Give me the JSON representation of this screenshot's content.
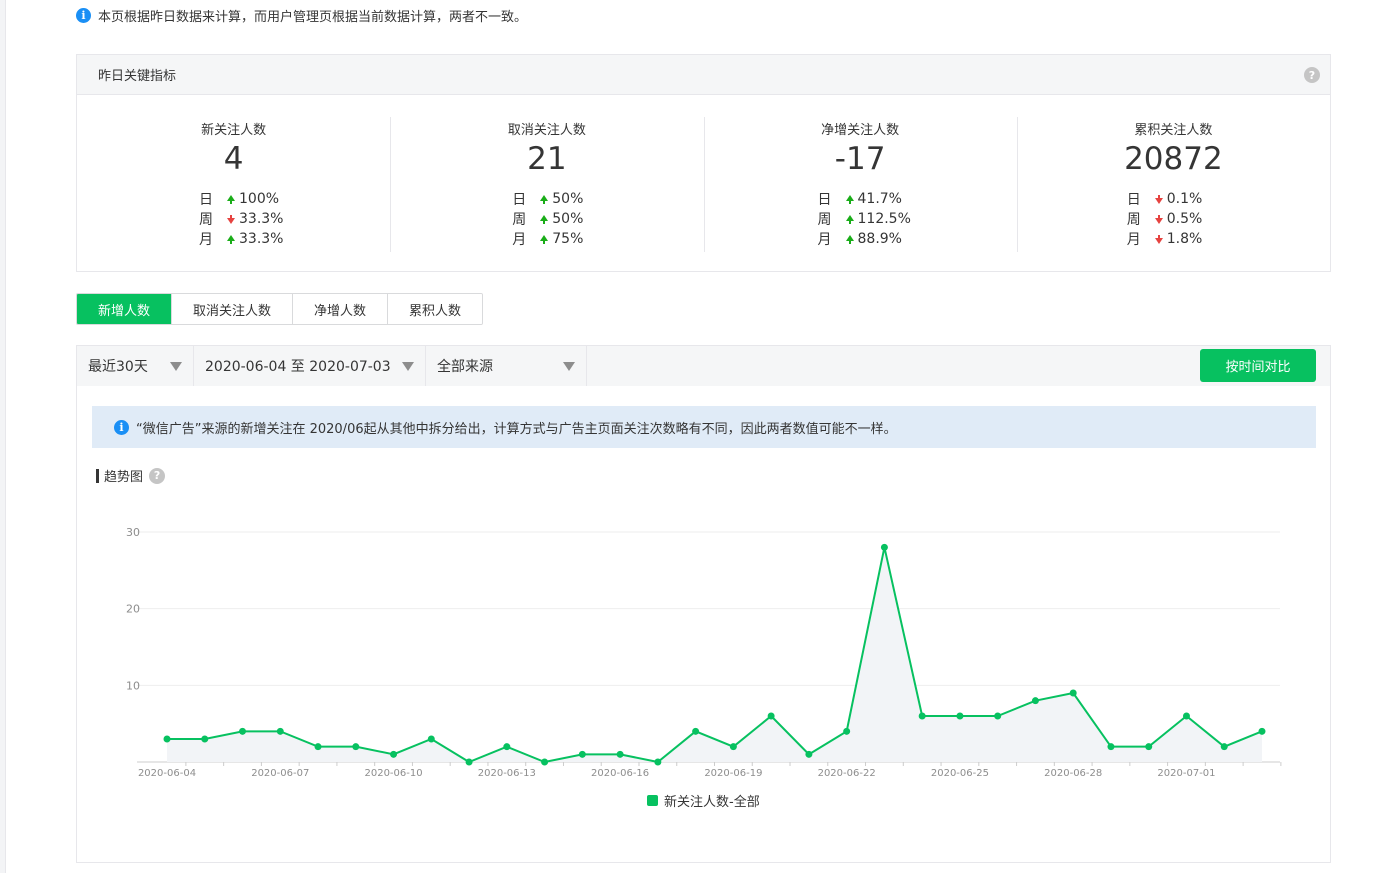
{
  "notice_top": "本页根据昨日数据来计算，而用户管理页根据当前数据计算，两者不一致。",
  "kpi_panel": {
    "title": "昨日关键指标",
    "help_icon": "question-mark-icon",
    "metrics": [
      {
        "title": "新关注人数",
        "value": "4",
        "rows": [
          {
            "label": "日",
            "dir": "up",
            "pct": "100%"
          },
          {
            "label": "周",
            "dir": "down",
            "pct": "33.3%"
          },
          {
            "label": "月",
            "dir": "up",
            "pct": "33.3%"
          }
        ]
      },
      {
        "title": "取消关注人数",
        "value": "21",
        "rows": [
          {
            "label": "日",
            "dir": "up",
            "pct": "50%"
          },
          {
            "label": "周",
            "dir": "up",
            "pct": "50%"
          },
          {
            "label": "月",
            "dir": "up",
            "pct": "75%"
          }
        ]
      },
      {
        "title": "净增关注人数",
        "value": "-17",
        "rows": [
          {
            "label": "日",
            "dir": "up",
            "pct": "41.7%"
          },
          {
            "label": "周",
            "dir": "up",
            "pct": "112.5%"
          },
          {
            "label": "月",
            "dir": "up",
            "pct": "88.9%"
          }
        ]
      },
      {
        "title": "累积关注人数",
        "value": "20872",
        "rows": [
          {
            "label": "日",
            "dir": "down",
            "pct": "0.1%"
          },
          {
            "label": "周",
            "dir": "down",
            "pct": "0.5%"
          },
          {
            "label": "月",
            "dir": "down",
            "pct": "1.8%"
          }
        ]
      }
    ]
  },
  "tabs": [
    {
      "label": "新增人数",
      "active": true
    },
    {
      "label": "取消关注人数",
      "active": false
    },
    {
      "label": "净增人数",
      "active": false
    },
    {
      "label": "累积人数",
      "active": false
    }
  ],
  "filters": {
    "range": "最近30天",
    "dates": "2020-06-04 至 2020-07-03",
    "source": "全部来源",
    "compare_button": "按时间对比"
  },
  "chart_notice": "“微信广告”来源的新增关注在 2020/06起从其他中拆分给出，计算方式与广告主页面关注次数略有不同，因此两者数值可能不一样。",
  "trend_title": "趋势图",
  "colors": {
    "accent": "#07c160",
    "up": "#1aad19",
    "down": "#e64340",
    "info": "#1a8ff5"
  },
  "chart_data": {
    "type": "area",
    "title": "",
    "xlabel": "",
    "ylabel": "",
    "ylim": [
      0,
      30
    ],
    "yticks": [
      10,
      20,
      30
    ],
    "grid": true,
    "legend_position": "bottom-center",
    "x": [
      "2020-06-04",
      "2020-06-05",
      "2020-06-06",
      "2020-06-07",
      "2020-06-08",
      "2020-06-09",
      "2020-06-10",
      "2020-06-11",
      "2020-06-12",
      "2020-06-13",
      "2020-06-14",
      "2020-06-15",
      "2020-06-16",
      "2020-06-17",
      "2020-06-18",
      "2020-06-19",
      "2020-06-20",
      "2020-06-21",
      "2020-06-22",
      "2020-06-23",
      "2020-06-24",
      "2020-06-25",
      "2020-06-26",
      "2020-06-27",
      "2020-06-28",
      "2020-06-29",
      "2020-06-30",
      "2020-07-01",
      "2020-07-02",
      "2020-07-03"
    ],
    "x_tick_labels": [
      "2020-06-04",
      "2020-06-07",
      "2020-06-10",
      "2020-06-13",
      "2020-06-16",
      "2020-06-19",
      "2020-06-22",
      "2020-06-25",
      "2020-06-28",
      "2020-07-01"
    ],
    "series": [
      {
        "name": "新关注人数-全部",
        "color": "#07c160",
        "values": [
          3,
          3,
          4,
          4,
          2,
          2,
          1,
          3,
          0,
          2,
          0,
          1,
          1,
          0,
          4,
          2,
          6,
          1,
          4,
          28,
          6,
          6,
          6,
          8,
          9,
          2,
          2,
          6,
          2,
          4
        ]
      }
    ]
  }
}
